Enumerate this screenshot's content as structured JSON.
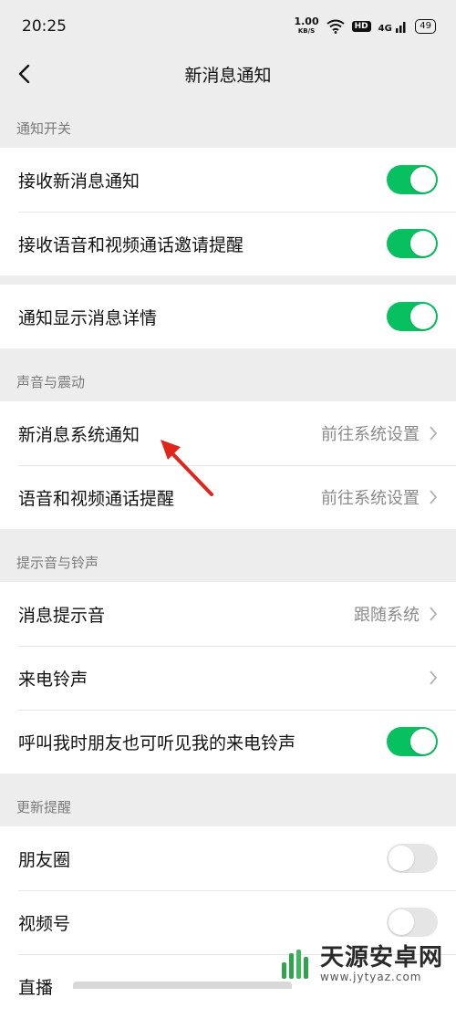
{
  "status_bar": {
    "time": "20:25",
    "net_speed": "1.00",
    "net_unit": "KB/S",
    "hd": "HD",
    "signal": "4G",
    "battery": "49"
  },
  "nav": {
    "title": "新消息通知"
  },
  "sections": {
    "notify_switch": {
      "header": "通知开关"
    },
    "sound_vibration": {
      "header": "声音与震动"
    },
    "tones_ringtones": {
      "header": "提示音与铃声"
    },
    "update_reminder": {
      "header": "更新提醒"
    }
  },
  "rows": {
    "receive_new": {
      "label": "接收新消息通知",
      "toggle": true
    },
    "receive_call": {
      "label": "接收语音和视频通话邀请提醒",
      "toggle": true
    },
    "show_detail": {
      "label": "通知显示消息详情",
      "toggle": true
    },
    "system_notify": {
      "label": "新消息系统通知",
      "value": "前往系统设置"
    },
    "call_remind": {
      "label": "语音和视频通话提醒",
      "value": "前往系统设置"
    },
    "msg_tone": {
      "label": "消息提示音",
      "value": "跟随系统"
    },
    "ringtone": {
      "label": "来电铃声"
    },
    "friends_hear": {
      "label": "呼叫我时朋友也可听见我的来电铃声",
      "toggle": true
    },
    "moments": {
      "label": "朋友圈",
      "toggle": false
    },
    "channels": {
      "label": "视频号",
      "toggle": false
    },
    "live": {
      "label": "直播"
    }
  },
  "watermark": {
    "name": "天源安卓网",
    "url": "www.jytyaz.com"
  },
  "colors": {
    "toggle_on": "#07c160",
    "toggle_off": "#e5e5e5",
    "annotation_arrow": "#e0251b"
  }
}
